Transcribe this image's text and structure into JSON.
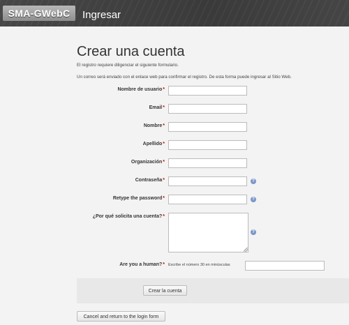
{
  "header": {
    "logo_text": "SMA-GWebC",
    "title": "Ingresar"
  },
  "page": {
    "title": "Crear una cuenta",
    "notes": [
      "El registro requiere diligenciar el siguiente formulario.",
      "Un correo será enviado con el enlace web para confirmar el registro. De esta forma puede ingresar al Sitio Web."
    ]
  },
  "form": {
    "required_marker": "*",
    "fields": [
      {
        "label": "Nombre de usuario",
        "value": "",
        "help": false
      },
      {
        "label": "Email",
        "value": "",
        "help": false
      },
      {
        "label": "Nombre",
        "value": "",
        "help": false
      },
      {
        "label": "Apellido",
        "value": "",
        "help": false
      },
      {
        "label": "Organización",
        "value": "",
        "help": false
      },
      {
        "label": "Contraseña",
        "value": "",
        "help": true
      },
      {
        "label": "Retype the password",
        "value": "",
        "help": true
      }
    ],
    "reason": {
      "label": "¿Por qué solicita una cuenta?",
      "value": "",
      "help": true
    },
    "captcha": {
      "label": "Are you a human?",
      "hint": "Escribe el número 30 en minúsculas",
      "value": ""
    },
    "help_icon": "help-question-icon",
    "submit_label": "Crear la cuenta",
    "cancel_label": "Cancel and return to the login form"
  },
  "colors": {
    "header_bg": "#3f3f3f",
    "required": "#cc0000",
    "help_icon": "#7a97c9"
  }
}
